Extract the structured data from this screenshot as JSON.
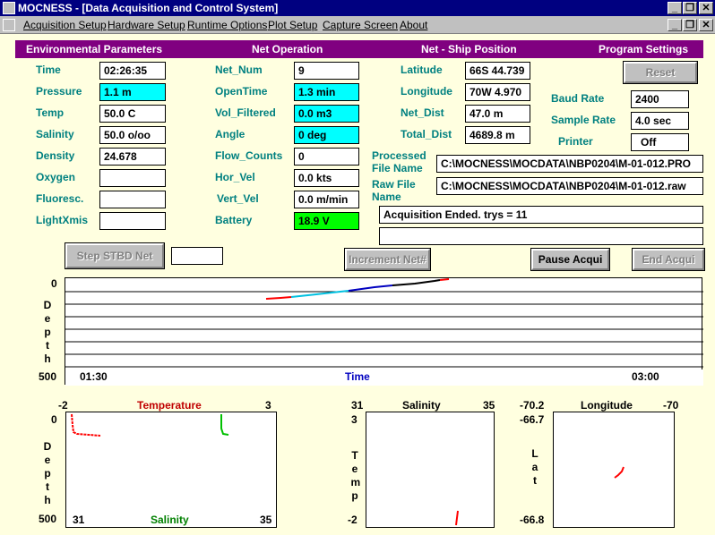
{
  "window": {
    "title": "MOCNESS - [Data Acquisition and Control System]"
  },
  "menu": [
    "Acquisition Setup",
    "Hardware Setup",
    "Runtime Options",
    "Plot Setup",
    "Capture Screen",
    "About"
  ],
  "sections": {
    "env": "Environmental Parameters",
    "net": "Net Operation",
    "pos": "Net - Ship Position",
    "prog": "Program Settings"
  },
  "env": [
    {
      "label": "Time",
      "value": "02:26:35"
    },
    {
      "label": "Pressure",
      "value": "1.1 m"
    },
    {
      "label": "Temp",
      "value": "50.0 C"
    },
    {
      "label": "Salinity",
      "value": "50.0 o/oo"
    },
    {
      "label": "Density",
      "value": "24.678"
    },
    {
      "label": "Oxygen",
      "value": ""
    },
    {
      "label": "Fluoresc.",
      "value": ""
    },
    {
      "label": "LightXmis",
      "value": ""
    }
  ],
  "net": [
    {
      "label": "Net_Num",
      "value": "9"
    },
    {
      "label": "OpenTime",
      "value": "1.3 min"
    },
    {
      "label": "Vol_Filtered",
      "value": "0.0 m3"
    },
    {
      "label": "Angle",
      "value": "0 deg"
    },
    {
      "label": "Flow_Counts",
      "value": "0"
    },
    {
      "label": "Hor_Vel",
      "value": "0.0 kts"
    },
    {
      "label": "Vert_Vel",
      "value": "0.0 m/min"
    },
    {
      "label": "Battery",
      "value": "18.9 V"
    }
  ],
  "pos": [
    {
      "label": "Latitude",
      "value": "66S 44.739"
    },
    {
      "label": "Longitude",
      "value": "70W 4.970"
    },
    {
      "label": "Net_Dist",
      "value": "47.0 m"
    },
    {
      "label": "Total_Dist",
      "value": "4689.8 m"
    }
  ],
  "prog": {
    "reset": "Reset",
    "baud_label": "Baud Rate",
    "baud": "2400",
    "sample_label": "Sample Rate",
    "sample": "4.0 sec",
    "printer_label": "Printer",
    "printer": "Off"
  },
  "files": {
    "processed_label": "Processed File Name",
    "processed": "C:\\MOCNESS\\MOCDATA\\NBP0204\\M-01-012.PRO",
    "raw_label": "Raw File Name",
    "raw": "C:\\MOCNESS\\MOCDATA\\NBP0204\\M-01-012.raw"
  },
  "status": {
    "line1": "Acquisition Ended.  trys = 11",
    "line2": ""
  },
  "buttons": {
    "step": "Step STBD Net",
    "step_value": "",
    "increment": "Increment Net#",
    "pause": "Pause Acqui",
    "end": "End Acqui"
  },
  "depth_time_plot": {
    "y_top": "0",
    "y_bottom": "500",
    "ylabel": "Depth",
    "x_start": "01:30",
    "x_end": "03:00",
    "xlabel": "Time",
    "colors": {
      "red": "#ff0000",
      "cyan": "#00c0e0",
      "blue": "#0000c0",
      "black": "#000000"
    }
  },
  "ts_plot": {
    "temp_min": "-2",
    "temp_max": "3",
    "temp_label": "Temperature",
    "sal_min": "31",
    "sal_max": "35",
    "sal_label": "Salinity",
    "y_top": "0",
    "y_bottom": "500",
    "ylabel": "Depth"
  },
  "sal_temp_plot": {
    "x_min": "31",
    "x_max": "35",
    "xlabel": "Salinity",
    "y_top": "3",
    "y_bottom": "-2",
    "ylabel": "Temp"
  },
  "lonlat_plot": {
    "x_min": "-70.2",
    "x_max": "-70",
    "xlabel": "Longitude",
    "y_top": "-66.7",
    "y_bottom": "-66.8",
    "ylabel": "Lat"
  }
}
